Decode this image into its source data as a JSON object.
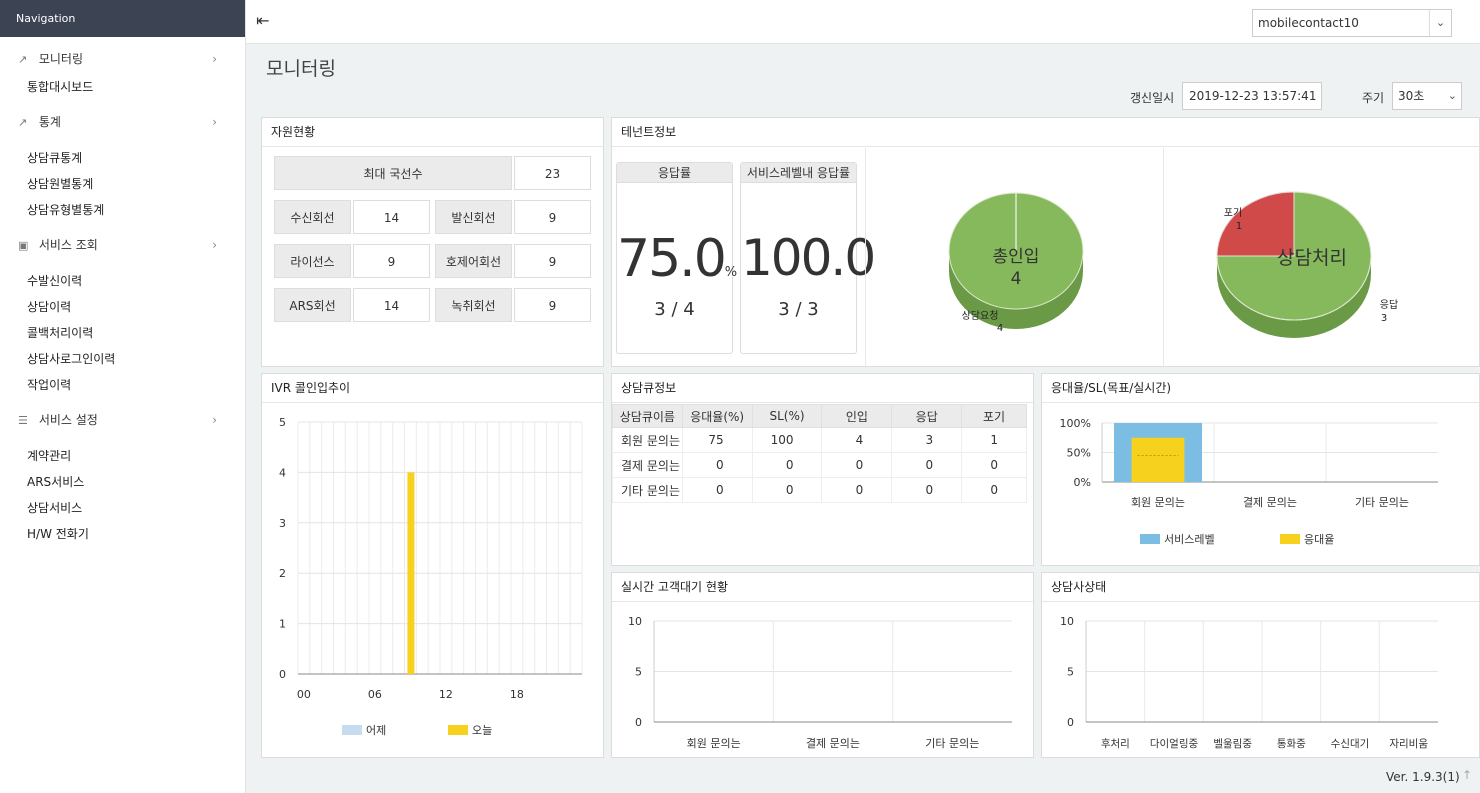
{
  "nav": {
    "header": "Navigation",
    "groups": [
      {
        "label": "모니터링",
        "icon": "external-link-icon",
        "items": [
          "통합대시보드"
        ]
      },
      {
        "label": "통계",
        "icon": "line-chart-icon",
        "items": [
          "상담큐통계",
          "상담원별통계",
          "상담유형별통계"
        ]
      },
      {
        "label": "서비스 조회",
        "icon": "calendar-check-icon",
        "items": [
          "수발신이력",
          "상담이력",
          "콜백처리이력",
          "상담사로그인이력",
          "작업이력"
        ]
      },
      {
        "label": "서비스 설정",
        "icon": "list-icon",
        "items": [
          "계약관리",
          "ARS서비스",
          "상담서비스",
          "H/W 전화기"
        ]
      }
    ]
  },
  "topbar": {
    "user": "mobilecontact10"
  },
  "page": {
    "title": "모니터링",
    "refresh_label": "갱신일시",
    "refresh_value": "2019-12-23 13:57:41",
    "period_label": "주기",
    "period_value": "30초"
  },
  "resources": {
    "title": "자원현황",
    "max_lines_label": "최대 국선수",
    "max_lines_value": "23",
    "rows": [
      [
        {
          "label": "수신회선",
          "value": "14"
        },
        {
          "label": "발신회선",
          "value": "9"
        }
      ],
      [
        {
          "label": "라이선스",
          "value": "9"
        },
        {
          "label": "호제어회선",
          "value": "9"
        }
      ],
      [
        {
          "label": "ARS회선",
          "value": "14"
        },
        {
          "label": "녹취회선",
          "value": "9"
        }
      ]
    ]
  },
  "tenant": {
    "title": "테넌트정보",
    "response_rate": {
      "label": "응답률",
      "value": "75.0",
      "unit": "%",
      "ratio": "3 / 4"
    },
    "sl_rate": {
      "label": "서비스레벨내 응답률",
      "value": "100.0",
      "ratio": "3 / 3"
    },
    "pie_inflow": {
      "center_label": "총인입",
      "center_value": "4",
      "slices": [
        {
          "label": "상담요청",
          "value": 4
        }
      ]
    },
    "pie_handled": {
      "center_label": "상담처리",
      "slices": [
        {
          "label": "포기",
          "value": 1
        },
        {
          "label": "응답",
          "value": 3
        }
      ]
    }
  },
  "ivr": {
    "title": "IVR 콜인입추이",
    "chart_data": {
      "type": "bar",
      "x": [
        9
      ],
      "x_ticks": [
        "00",
        "06",
        "12",
        "18"
      ],
      "ylim": [
        0,
        5
      ],
      "y_ticks": [
        "0",
        "1",
        "2",
        "3",
        "4",
        "5"
      ],
      "series": [
        {
          "name": "어제",
          "color": "#c6dcf0",
          "values": []
        },
        {
          "name": "오늘",
          "color": "#f6d21f",
          "values": [
            4
          ]
        }
      ]
    }
  },
  "queue": {
    "title": "상담큐정보",
    "headers": [
      "상담큐이름",
      "응대율(%)",
      "SL(%)",
      "인입",
      "응답",
      "포기"
    ],
    "rows": [
      [
        "회원 문의는",
        "75",
        "100",
        "4",
        "3",
        "1"
      ],
      [
        "결제 문의는",
        "0",
        "0",
        "0",
        "0",
        "0"
      ],
      [
        "기타 문의는",
        "0",
        "0",
        "0",
        "0",
        "0"
      ]
    ]
  },
  "sl": {
    "title": "응대율/SL(목표/실시간)",
    "chart_data": {
      "type": "bar",
      "categories": [
        "회원 문의는",
        "결제 문의는",
        "기타 문의는"
      ],
      "y_ticks": [
        "0%",
        "50%",
        "100%"
      ],
      "ylim": [
        0,
        100
      ],
      "series": [
        {
          "name": "서비스레벨",
          "color": "#7bbde3",
          "values": [
            100,
            0,
            0
          ]
        },
        {
          "name": "응대율",
          "color": "#f6d21f",
          "values": [
            75,
            0,
            0
          ]
        }
      ]
    }
  },
  "waiting": {
    "title": "실시간 고객대기 현황",
    "chart_data": {
      "type": "bar",
      "categories": [
        "회원 문의는",
        "결제 문의는",
        "기타 문의는"
      ],
      "y_ticks": [
        "0",
        "5",
        "10"
      ],
      "ylim": [
        0,
        10
      ],
      "values": [
        0,
        0,
        0
      ]
    }
  },
  "agents": {
    "title": "상담사상태",
    "chart_data": {
      "type": "bar",
      "categories": [
        "후처리",
        "다이얼링중",
        "벨울림중",
        "통화중",
        "수신대기",
        "자리비움"
      ],
      "y_ticks": [
        "0",
        "5",
        "10"
      ],
      "ylim": [
        0,
        10
      ],
      "values": [
        0,
        0,
        0,
        0,
        0,
        0
      ]
    }
  },
  "footer": {
    "version": "Ver. 1.9.3(1)"
  }
}
